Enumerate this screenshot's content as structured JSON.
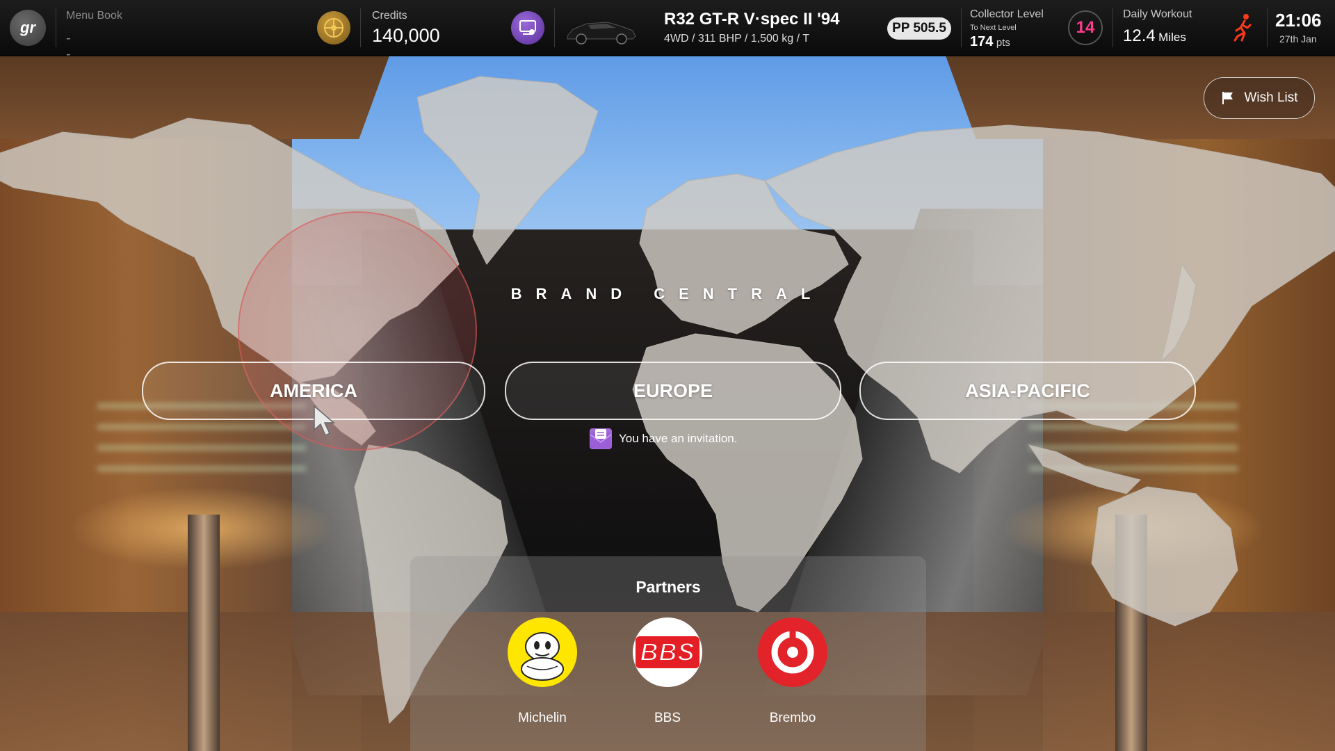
{
  "topbar": {
    "menu_book_label": "Menu Book",
    "menu_book_value": "--",
    "credits_label": "Credits",
    "credits_value": "140,000",
    "car_name": "R32 GT-R V·spec II '94",
    "car_specs": "4WD / 311 BHP / 1,500 kg / T",
    "pp_value": "PP 505.5",
    "collector_label": "Collector Level",
    "collector_sub": "To Next Level",
    "collector_pts": "174",
    "collector_pts_unit": "pts",
    "collector_level": "14",
    "workout_label": "Daily Workout",
    "workout_value": "12.4",
    "workout_unit": "Miles",
    "time": "21:06",
    "date": "27th Jan"
  },
  "wish_list_label": "Wish List",
  "brand_title": "BRAND CENTRAL",
  "regions": [
    "AMERICA",
    "EUROPE",
    "ASIA-PACIFIC"
  ],
  "invitation_text": "You have an invitation.",
  "partners": {
    "title": "Partners",
    "items": [
      {
        "name": "Michelin",
        "logo_text": ""
      },
      {
        "name": "BBS",
        "logo_text": "BBS"
      },
      {
        "name": "Brembo",
        "logo_text": ""
      }
    ]
  },
  "colors": {
    "level_accent": "#ff3c8e",
    "invite_icon": "#a46ad8",
    "michelin_bg": "#ffe600",
    "bbs_red": "#e31e24",
    "brembo_red": "#e2232a"
  }
}
